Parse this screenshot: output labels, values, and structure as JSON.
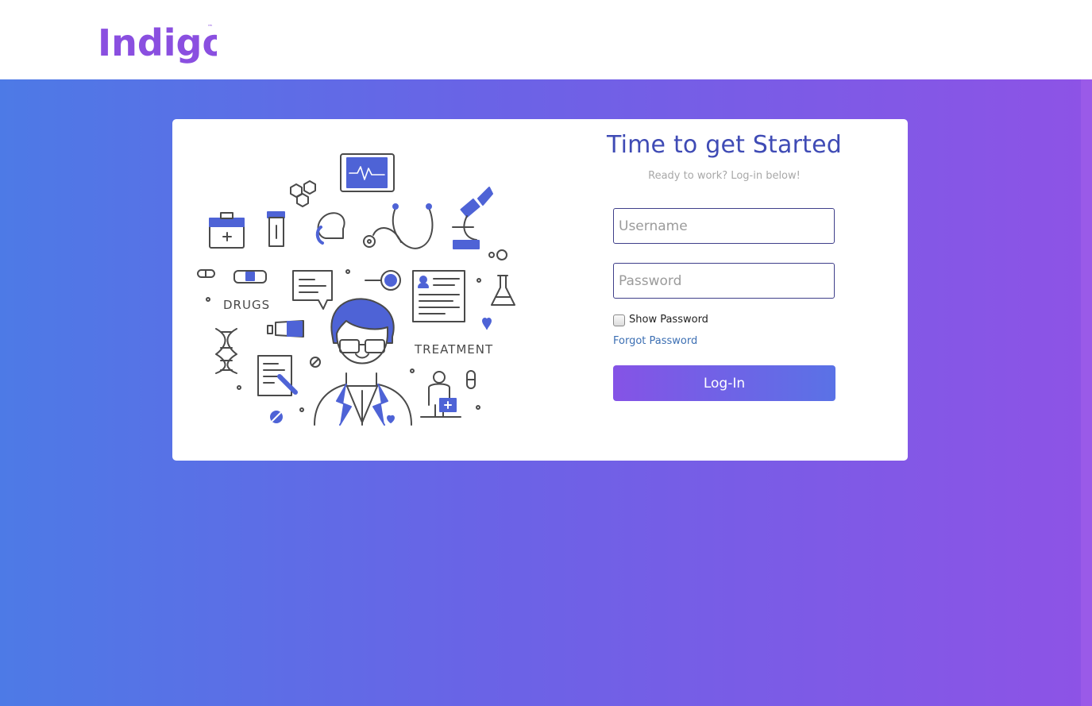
{
  "brand": {
    "logo_text": "Indigo",
    "trademark": "™",
    "logo_color": "#8a4fe0"
  },
  "colors": {
    "accent": "#3f4bb5",
    "illustration_blue": "#4e63d6",
    "illustration_line": "#4a4a4a",
    "gradient_start": "#4d7ae6",
    "gradient_end": "#8d53e6"
  },
  "illustration": {
    "drugs_label": "DRUGS",
    "treatment_label": "TREATMENT"
  },
  "login": {
    "title": "Time to get Started",
    "subtitle": "Ready to work? Log-in below!",
    "username_placeholder": "Username",
    "username_value": "",
    "password_placeholder": "Password",
    "password_value": "",
    "show_password_label": "Show Password",
    "show_password_checked": false,
    "forgot_password_label": "Forgot Password",
    "login_button_label": "Log-In"
  }
}
